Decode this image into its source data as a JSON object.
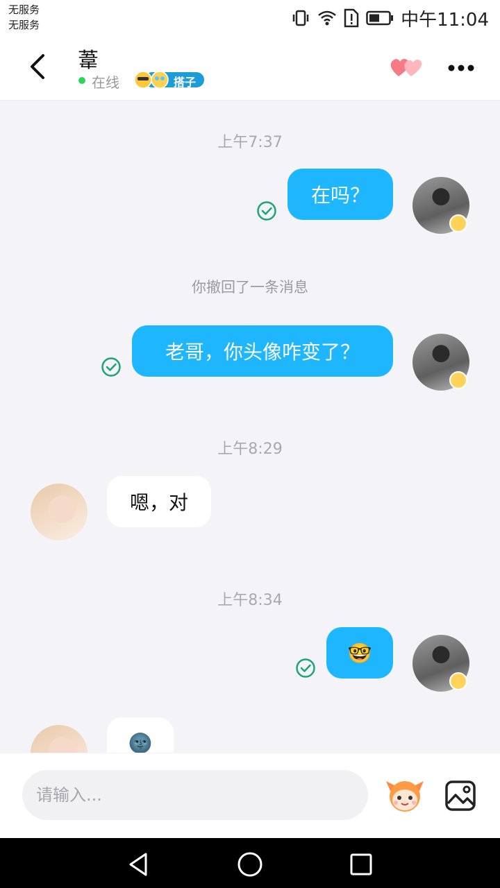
{
  "status_bar": {
    "carrier_line1": "无服务",
    "carrier_line2": "无服务",
    "time": "中午11:04",
    "icons": [
      "vibrate-icon",
      "wifi-icon",
      "sim-alert-icon",
      "battery-icon"
    ]
  },
  "header": {
    "title": "葦",
    "presence": "在线",
    "badge_label": "搭子"
  },
  "messages": [
    {
      "kind": "timestamp",
      "text": "上午7:37"
    },
    {
      "kind": "outgoing",
      "text": "在吗？"
    },
    {
      "kind": "system",
      "text": "你撤回了一条消息"
    },
    {
      "kind": "outgoing",
      "text": "老哥，你头像咋变了？"
    },
    {
      "kind": "timestamp",
      "text": "上午8:29"
    },
    {
      "kind": "incoming",
      "text": "嗯，对"
    },
    {
      "kind": "timestamp",
      "text": "上午8:34"
    },
    {
      "kind": "outgoing",
      "text": "🤓"
    },
    {
      "kind": "incoming",
      "text": "🌚"
    }
  ],
  "composer": {
    "placeholder": "请输入..."
  },
  "colors": {
    "accent": "#1eb6ff",
    "check": "#1aa571",
    "online": "#2bd55b"
  }
}
